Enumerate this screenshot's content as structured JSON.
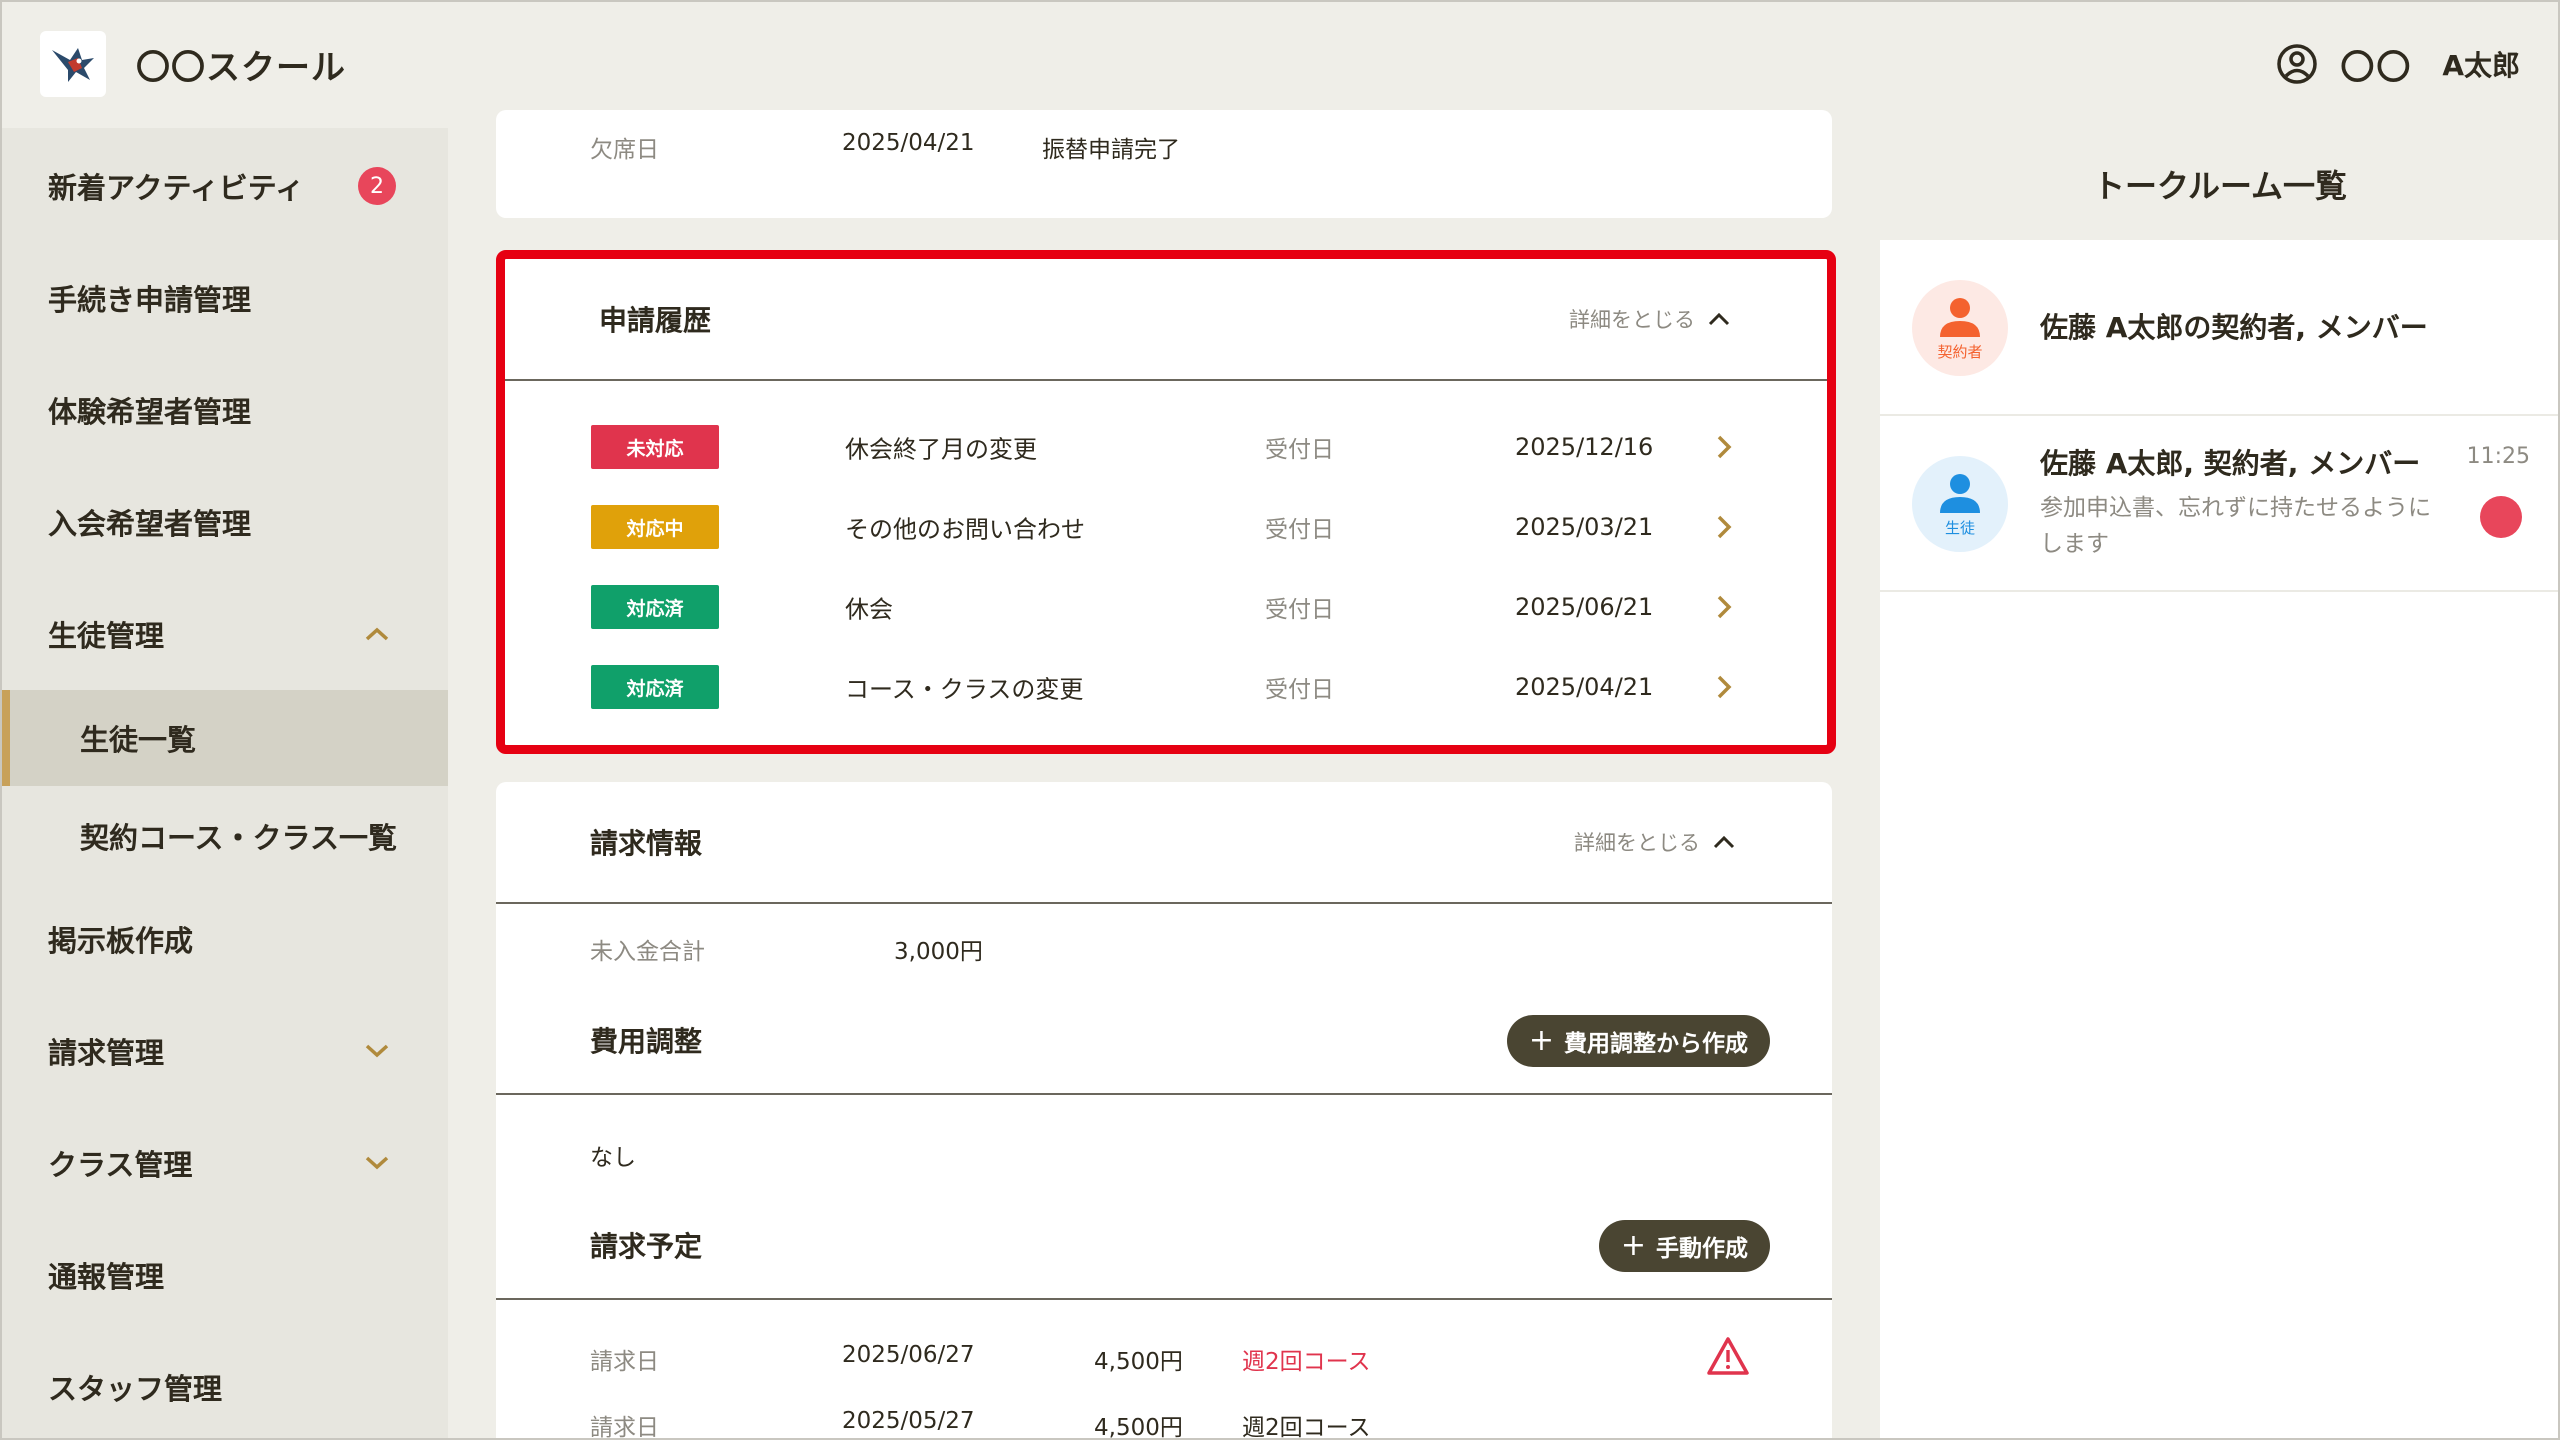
{
  "header": {
    "app_title": "〇〇スクール",
    "org": "〇〇",
    "user_name": "A太郎"
  },
  "sidebar": {
    "items": [
      {
        "label": "新着アクティビティ",
        "badge": "2"
      },
      {
        "label": "手続き申請管理"
      },
      {
        "label": "体験希望者管理"
      },
      {
        "label": "入会希望者管理"
      },
      {
        "label": "生徒管理",
        "expanded": true
      },
      {
        "label": "生徒一覧",
        "active": true
      },
      {
        "label": "契約コース・クラス一覧"
      },
      {
        "label": "掲示板作成"
      },
      {
        "label": "請求管理",
        "expanded": false
      },
      {
        "label": "クラス管理",
        "expanded": false
      },
      {
        "label": "通報管理"
      },
      {
        "label": "スタッフ管理"
      }
    ]
  },
  "absence_card": {
    "label": "欠席日",
    "date": "2025/04/21",
    "status": "振替申請完了"
  },
  "history": {
    "title": "申請履歴",
    "collapse_label": "詳細をとじる",
    "rows": [
      {
        "status": "未対応",
        "status_color": "#e0344d",
        "title": "休会終了月の変更",
        "label": "受付日",
        "date": "2025/12/16"
      },
      {
        "status": "対応中",
        "status_color": "#e0a10a",
        "title": "その他のお問い合わせ",
        "label": "受付日",
        "date": "2025/03/21"
      },
      {
        "status": "対応済",
        "status_color": "#10a06a",
        "title": "休会",
        "label": "受付日",
        "date": "2025/06/21"
      },
      {
        "status": "対応済",
        "status_color": "#10a06a",
        "title": "コース・クラスの変更",
        "label": "受付日",
        "date": "2025/04/21"
      }
    ]
  },
  "billing": {
    "title": "請求情報",
    "collapse_label": "詳細をとじる",
    "unpaid_label": "未入金合計",
    "unpaid_value": "3,000円",
    "adjust_title": "費用調整",
    "adjust_button": "費用調整から作成",
    "adjust_value": "なし",
    "schedule_title": "請求予定",
    "manual_button": "手動作成",
    "rows": [
      {
        "label": "請求日",
        "date": "2025/06/27",
        "amount": "4,500円",
        "course": "週2回コース",
        "warning": true
      },
      {
        "label": "請求日",
        "date": "2025/05/27",
        "amount": "4,500円",
        "course": "週2回コース",
        "warning": false
      }
    ]
  },
  "talk": {
    "title": "トークルーム一覧",
    "rooms": [
      {
        "avatar_caption": "契約者",
        "name": "佐藤 A太郎の契約者, メンバー"
      },
      {
        "avatar_caption": "生徒",
        "name": "佐藤 A太郎, 契約者, メンバー",
        "message": "参加申込書、忘れずに持たせるようにします",
        "time": "11:25",
        "unread": true
      }
    ]
  },
  "colors": {
    "accent_gold": "#c8a15a",
    "highlight_red": "#e60012",
    "dark_button": "#4a4532",
    "badge_red": "#e8465b"
  }
}
